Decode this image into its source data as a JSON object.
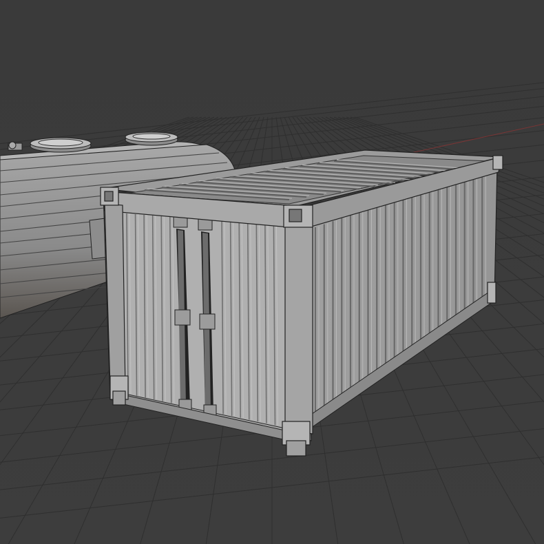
{
  "viewport": {
    "background_top": "#3a3a3a",
    "background_bottom": "#3d3d3d",
    "grid_color": "#2f2f2f",
    "axis_x_color": "#8a3a3a"
  },
  "objects": [
    {
      "name": "shipping-container",
      "color_face": "#a0a0a0",
      "color_edge": "#2a2a2a"
    },
    {
      "name": "tank-car",
      "color_face": "#9a9a9a"
    }
  ]
}
